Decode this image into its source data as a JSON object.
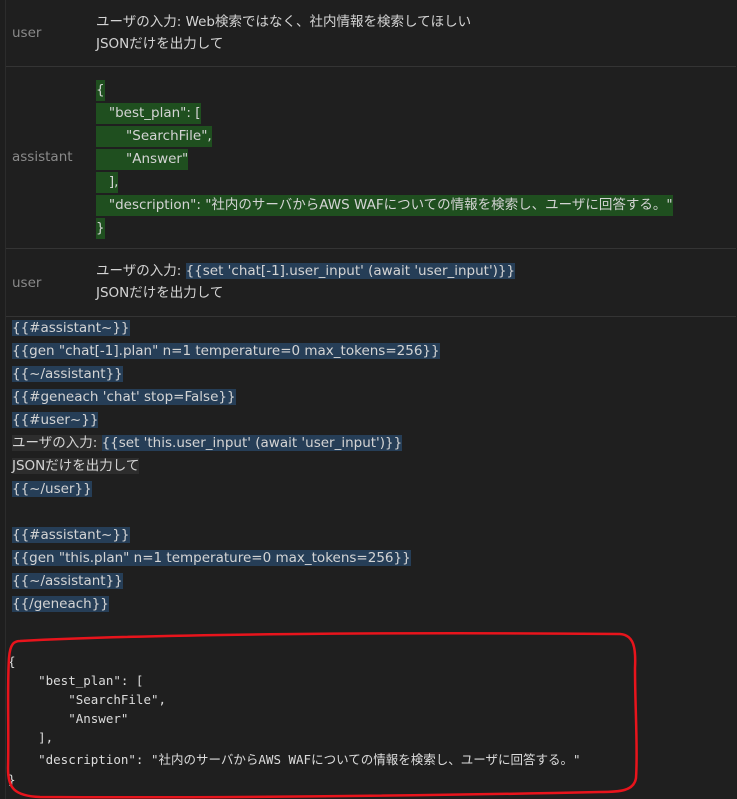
{
  "messages": [
    {
      "role": "user",
      "lines": [
        "ユーザの入力: Web検索ではなく、社内情報を検索してほしい",
        "JSONだけを出力して"
      ]
    },
    {
      "role": "assistant",
      "lines": [
        "{",
        "   \"best_plan\": [",
        "       \"SearchFile\",",
        "       \"Answer\"",
        "   ],",
        "   \"description\": \"社内のサーバからAWS WAFについての情報を検索し、ユーザに回答する。\"",
        "}"
      ]
    },
    {
      "role": "user",
      "line1_prefix": "ユーザの入力: ",
      "line1_code": "{{set 'chat[-1].user_input' (await 'user_input')}}",
      "line2": "JSONだけを出力して"
    }
  ],
  "template_lines": [
    {
      "text": "{{#assistant~}}",
      "style": "blue"
    },
    {
      "text": "{{gen \"chat[-1].plan\" n=1 temperature=0 max_tokens=256}}",
      "style": "blue"
    },
    {
      "text": "{{~/assistant}}",
      "style": "blue"
    },
    {
      "text": "{{#geneach 'chat' stop=False}}",
      "style": "blue"
    },
    {
      "text": "{{#user~}}",
      "style": "blue"
    },
    {
      "prefix": "ユーザの入力: ",
      "text": "{{set 'this.user_input' (await 'user_input')}}",
      "style": "mixed"
    },
    {
      "text": "JSONだけを出力して",
      "style": "grey"
    },
    {
      "text": "{{~/user}}",
      "style": "blue"
    },
    {
      "text": "",
      "style": "none"
    },
    {
      "text": "{{#assistant~}}",
      "style": "blue"
    },
    {
      "text": "{{gen \"this.plan\" n=1 temperature=0 max_tokens=256}}",
      "style": "blue"
    },
    {
      "text": "{{~/assistant}}",
      "style": "blue"
    },
    {
      "text": "{{/geneach}}",
      "style": "blue"
    }
  ],
  "output_lines": [
    "{",
    "    \"best_plan\": [",
    "        \"SearchFile\",",
    "        \"Answer\"",
    "    ],",
    "    \"description\": \"社内のサーバからAWS WAFについての情報を検索し、ユーザに回答する。\"",
    "}"
  ],
  "colors": {
    "background": "#1e1e1e",
    "green_highlight": "#1f4f1f",
    "blue_highlight": "#263e57",
    "annotation_red": "#e8141c"
  }
}
